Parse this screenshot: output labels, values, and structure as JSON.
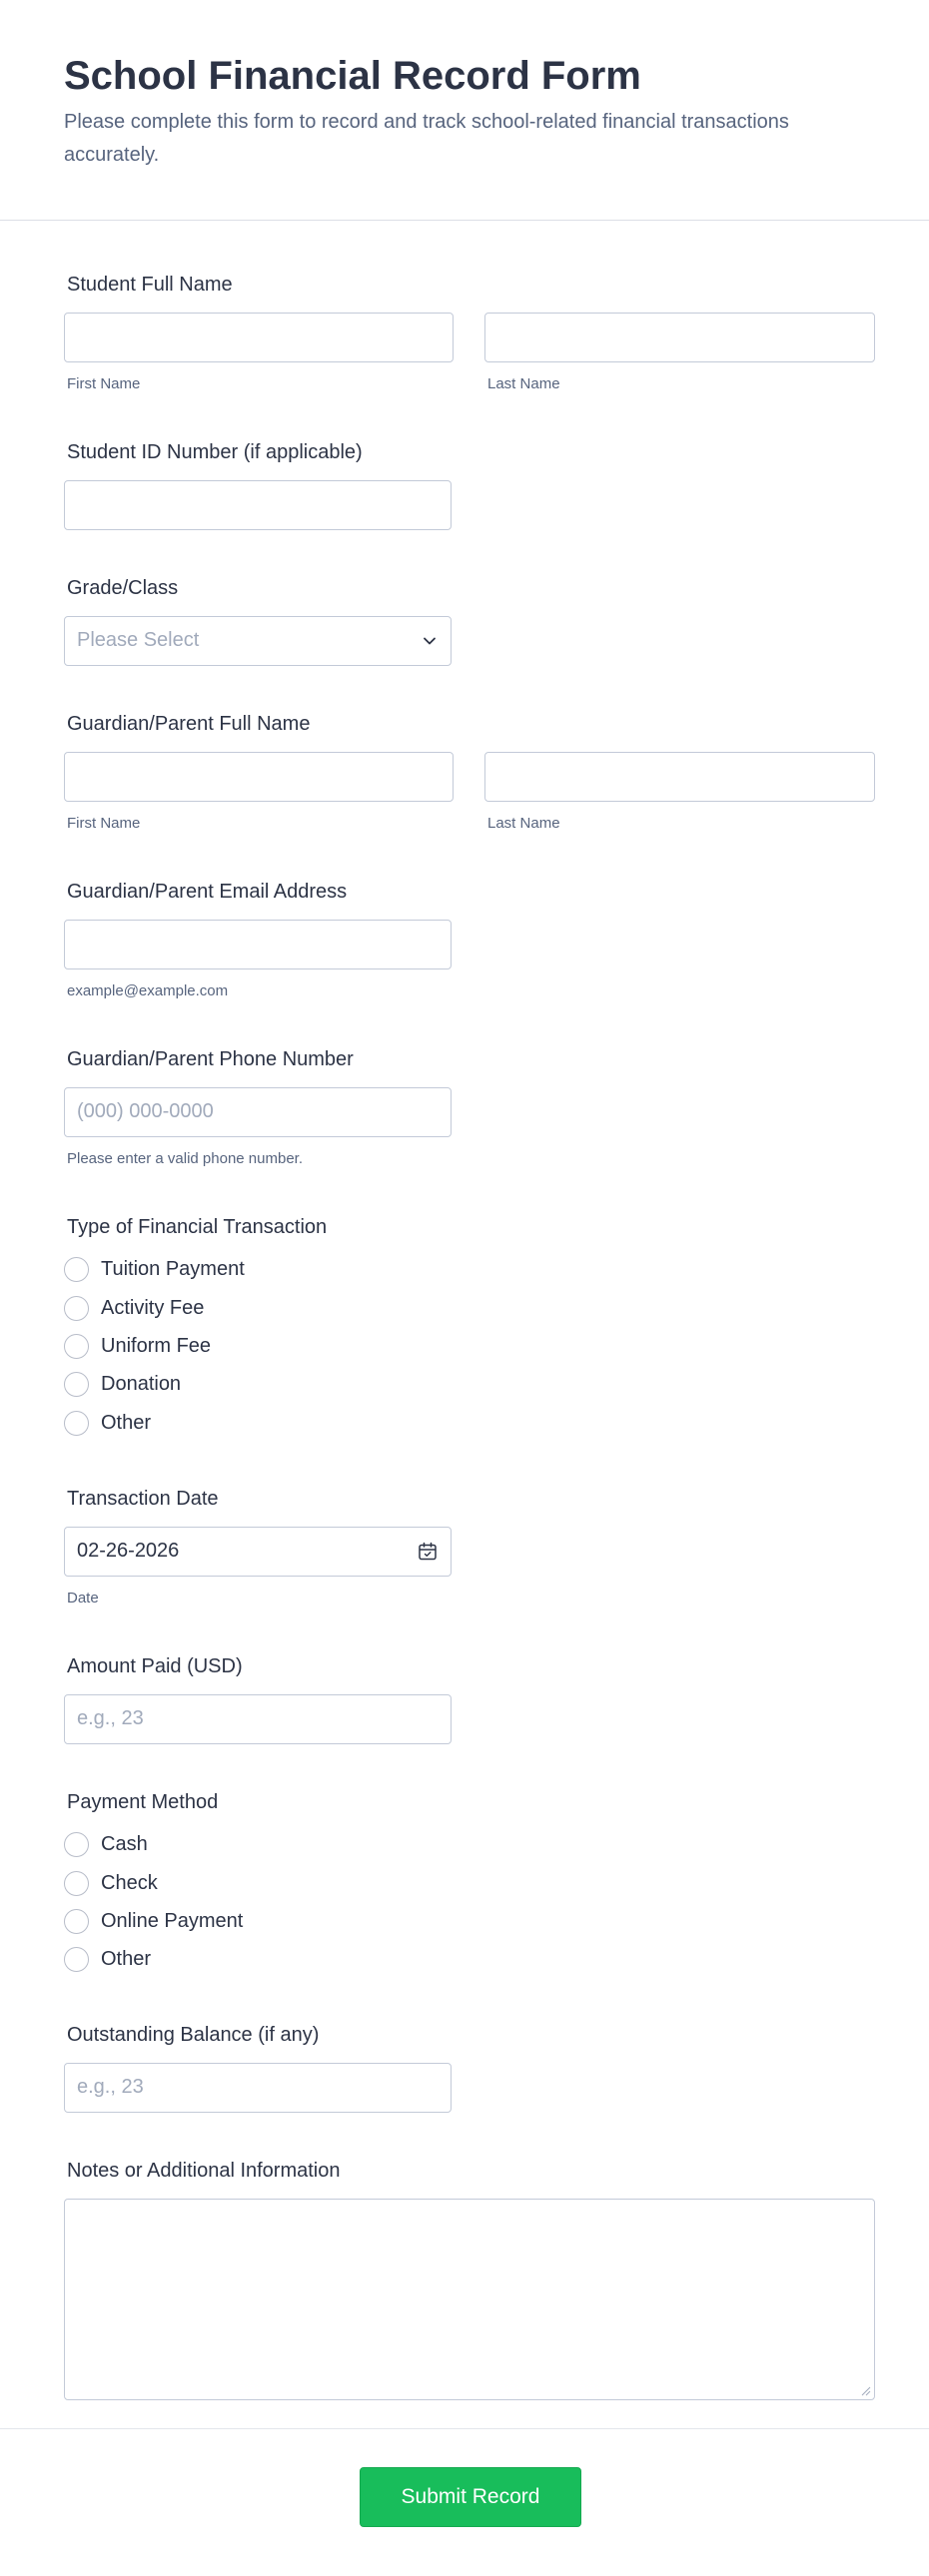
{
  "header": {
    "title": "School Financial Record Form",
    "subtitle": "Please complete this form to record and track school-related financial transactions accurately."
  },
  "student_name": {
    "label": "Student Full Name",
    "first_sublabel": "First Name",
    "last_sublabel": "Last Name",
    "first_value": "",
    "last_value": ""
  },
  "student_id": {
    "label": "Student ID Number (if applicable)",
    "value": ""
  },
  "grade": {
    "label": "Grade/Class",
    "placeholder": "Please Select"
  },
  "guardian_name": {
    "label": "Guardian/Parent Full Name",
    "first_sublabel": "First Name",
    "last_sublabel": "Last Name",
    "first_value": "",
    "last_value": ""
  },
  "guardian_email": {
    "label": "Guardian/Parent Email Address",
    "sublabel": "example@example.com",
    "value": ""
  },
  "guardian_phone": {
    "label": "Guardian/Parent Phone Number",
    "placeholder": "(000) 000-0000",
    "sublabel": "Please enter a valid phone number."
  },
  "transaction_type": {
    "label": "Type of Financial Transaction",
    "options": [
      "Tuition Payment",
      "Activity Fee",
      "Uniform Fee",
      "Donation",
      "Other"
    ]
  },
  "transaction_date": {
    "label": "Transaction Date",
    "value": "02-26-2026",
    "sublabel": "Date"
  },
  "amount_paid": {
    "label": "Amount Paid (USD)",
    "placeholder": "e.g., 23"
  },
  "payment_method": {
    "label": "Payment Method",
    "options": [
      "Cash",
      "Check",
      "Online Payment",
      "Other"
    ]
  },
  "outstanding_balance": {
    "label": "Outstanding Balance (if any)",
    "placeholder": "e.g., 23"
  },
  "notes": {
    "label": "Notes or Additional Information",
    "value": ""
  },
  "footer": {
    "submit_label": "Submit Record"
  },
  "colors": {
    "primary_text": "#2c3345",
    "secondary_text": "#57647e",
    "placeholder": "#a1aabb",
    "border": "#c3cad8",
    "submit": "#18bd5b"
  },
  "icons": {
    "grade_dropdown": "chevron-down-icon",
    "date_picker": "calendar-icon"
  }
}
